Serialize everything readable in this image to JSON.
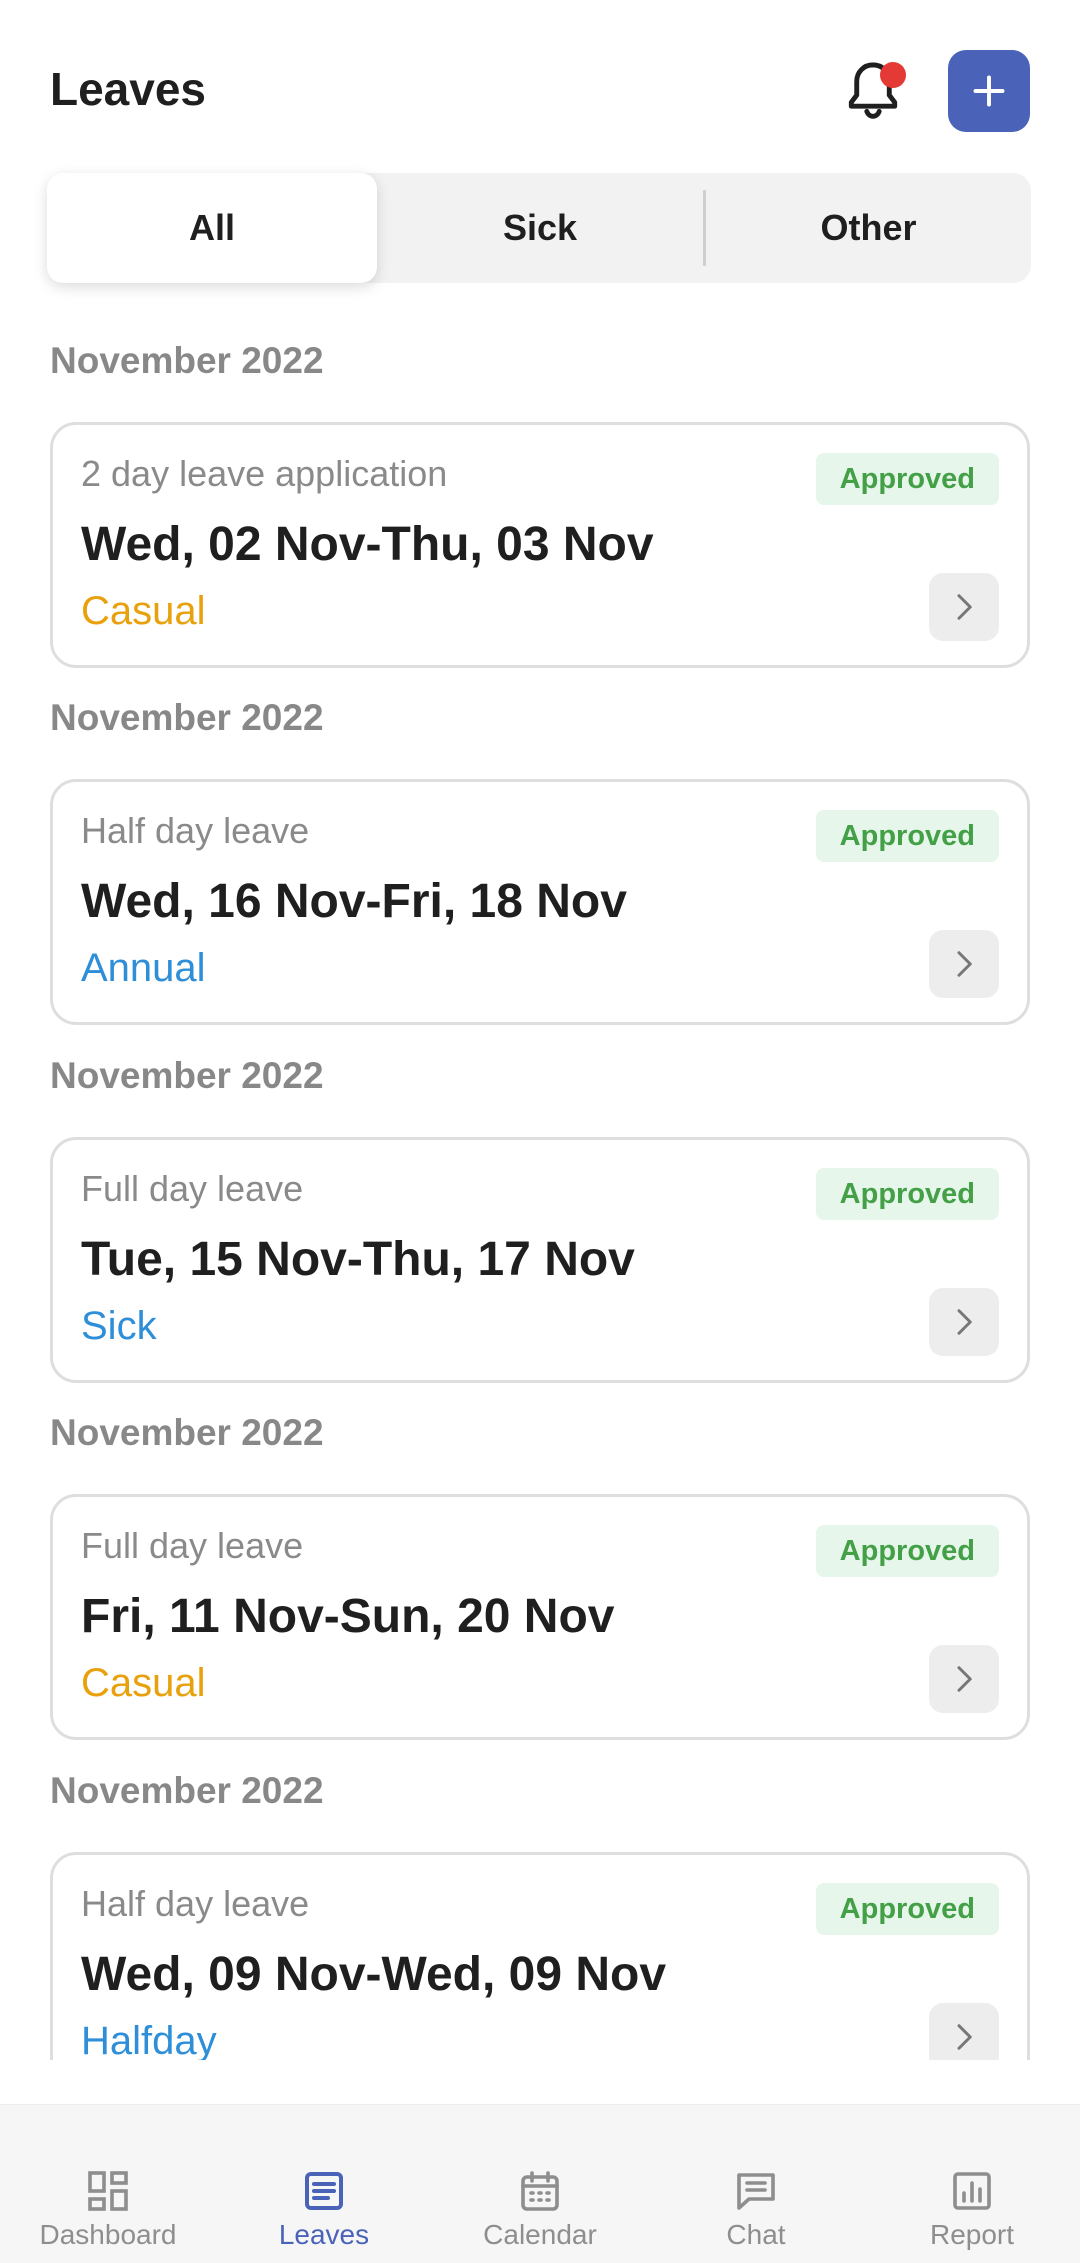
{
  "header": {
    "title": "Leaves",
    "bell_icon": "bell-icon",
    "add_icon": "plus-icon",
    "accent_color": "#4a63b8",
    "notification_dot_color": "#e53935"
  },
  "tabs": [
    {
      "label": "All",
      "active": true
    },
    {
      "label": "Sick",
      "active": false
    },
    {
      "label": "Other",
      "active": false
    }
  ],
  "leaves": [
    {
      "group_title": "November 2022",
      "subtitle": "2 day leave application",
      "dates": "Wed, 02 Nov-Thu, 03 Nov",
      "type": "Casual",
      "type_color": "#e8a10c",
      "status": "Approved"
    },
    {
      "group_title": "November 2022",
      "subtitle": "Half day leave",
      "dates": "Wed, 16 Nov-Fri, 18 Nov",
      "type": "Annual",
      "type_color": "#2e8fd8",
      "status": "Approved"
    },
    {
      "group_title": "November 2022",
      "subtitle": "Full day leave",
      "dates": "Tue, 15 Nov-Thu, 17 Nov",
      "type": "Sick",
      "type_color": "#2e8fd8",
      "status": "Approved"
    },
    {
      "group_title": "November 2022",
      "subtitle": "Full day leave",
      "dates": "Fri, 11 Nov-Sun, 20 Nov",
      "type": "Casual",
      "type_color": "#e8a10c",
      "status": "Approved"
    },
    {
      "group_title": "November 2022",
      "subtitle": "Half day leave",
      "dates": "Wed, 09 Nov-Wed, 09 Nov",
      "type": "Halfday",
      "type_color": "#2e8fd8",
      "status": "Approved"
    }
  ],
  "status_colors": {
    "approved_bg": "#e7f6ea",
    "approved_text": "#43a047"
  },
  "bottom_nav": [
    {
      "label": "Dashboard",
      "icon": "dashboard-icon",
      "active": false
    },
    {
      "label": "Leaves",
      "icon": "leaves-icon",
      "active": true
    },
    {
      "label": "Calendar",
      "icon": "calendar-icon",
      "active": false
    },
    {
      "label": "Chat",
      "icon": "chat-icon",
      "active": false
    },
    {
      "label": "Report",
      "icon": "report-icon",
      "active": false
    }
  ]
}
